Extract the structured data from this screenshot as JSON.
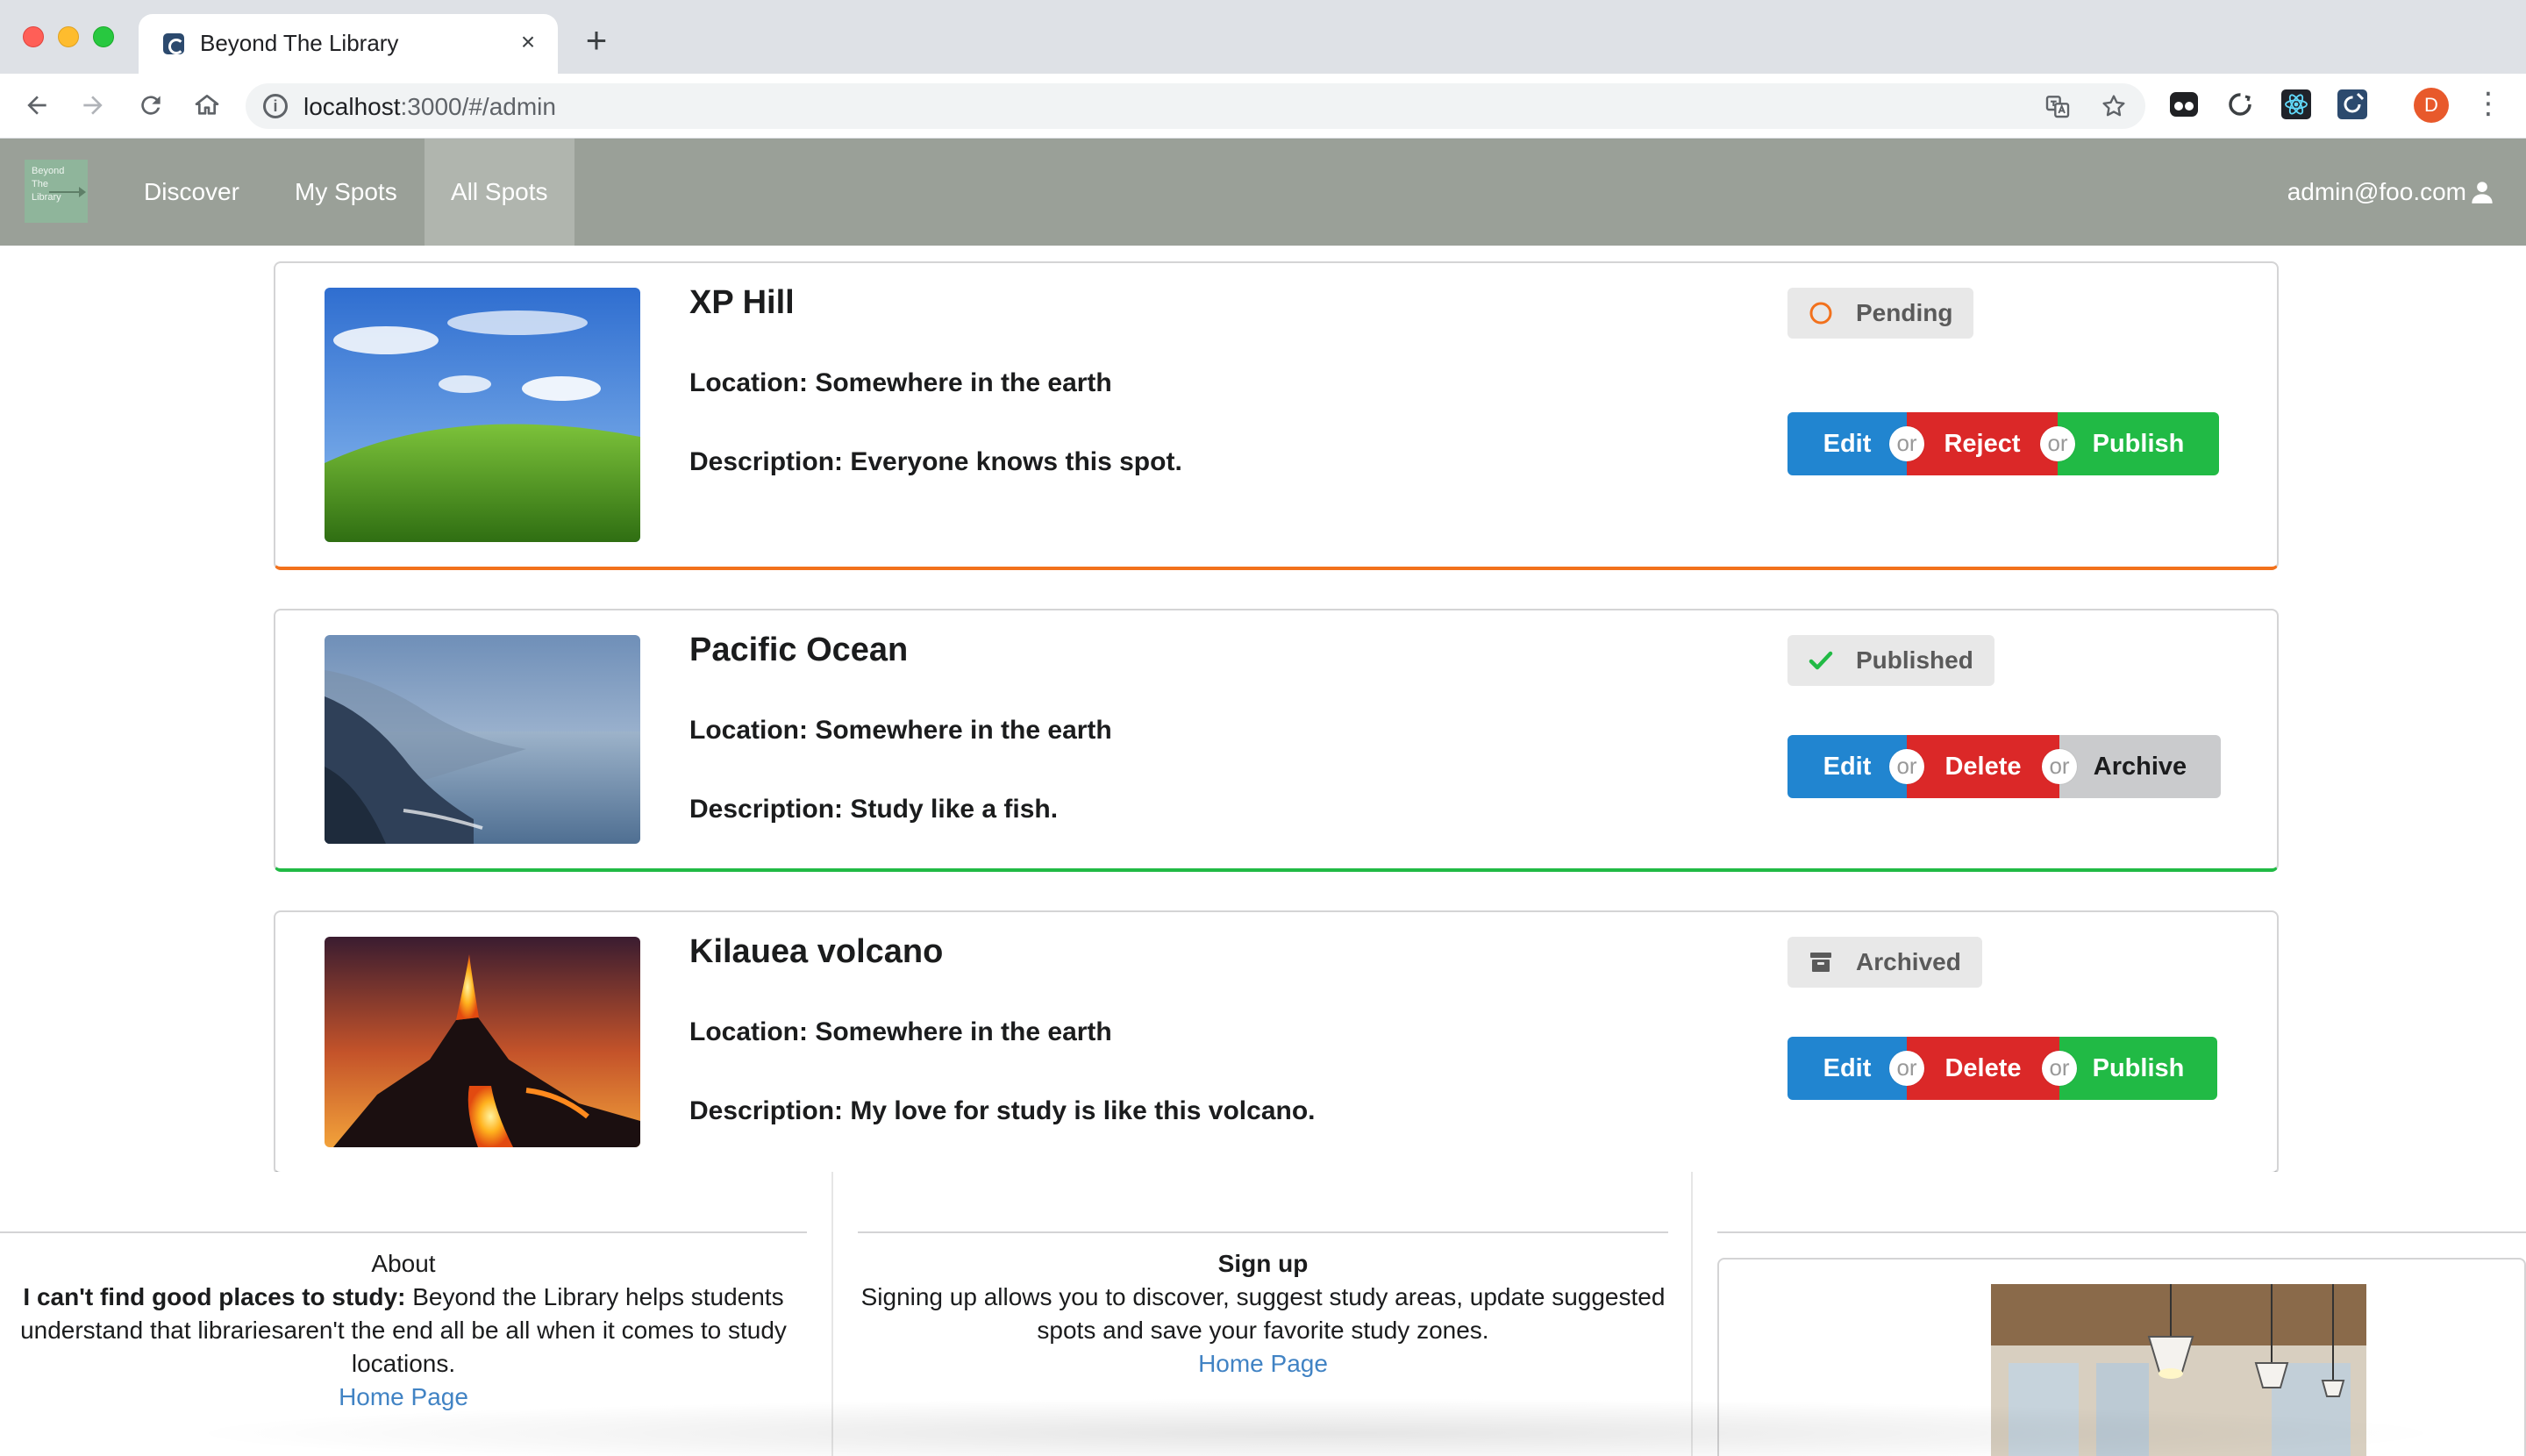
{
  "browser": {
    "tab_title": "Beyond The Library",
    "tab_close": "×",
    "new_tab": "+",
    "url_host": "localhost",
    "url_rest": ":3000/#/admin",
    "avatar_letter": "D",
    "menu_glyph": "⋮"
  },
  "nav": {
    "logo_lines": [
      "Beyond",
      "The",
      "Library"
    ],
    "items": [
      "Discover",
      "My Spots",
      "All Spots"
    ],
    "active_item": "All Spots",
    "user_email": "admin@foo.com"
  },
  "connector_label": "or",
  "spots": [
    {
      "title": "XP Hill",
      "location": "Location: Somewhere in the earth",
      "description": "Description: Everyone knows this spot.",
      "status": "Pending",
      "status_icon": "circle-outline-icon",
      "actions": [
        "Edit",
        "Reject",
        "Publish"
      ],
      "accent": "#f2711c"
    },
    {
      "title": "Pacific Ocean",
      "location": "Location: Somewhere in the earth",
      "description": "Description: Study like a fish.",
      "status": "Published",
      "status_icon": "checkmark-icon",
      "actions": [
        "Edit",
        "Delete",
        "Archive"
      ],
      "accent": "#21ba45"
    },
    {
      "title": "Kilauea volcano",
      "location": "Location: Somewhere in the earth",
      "description": "Description: My love for study is like this volcano.",
      "status": "Archived",
      "status_icon": "archive-box-icon",
      "actions": [
        "Edit",
        "Delete",
        "Publish"
      ],
      "accent": "#aeb0b2"
    }
  ],
  "footer": {
    "about": {
      "heading": "About",
      "bold_lead": "I can't find good places to study:",
      "body": " Beyond the Library helps students understand that librariesaren't the end all be all when it comes to study locations.",
      "link": "Home Page"
    },
    "signup": {
      "heading": "Sign up",
      "body": "Signing up allows you to discover, suggest study areas, update suggested spots and save your favorite study zones.",
      "link": "Home Page"
    }
  },
  "colors": {
    "nav_bg": "#9aa098",
    "edit_blue": "#2185d0",
    "danger_red": "#db2828",
    "success_green": "#21ba45",
    "link_blue": "#4183c4"
  }
}
